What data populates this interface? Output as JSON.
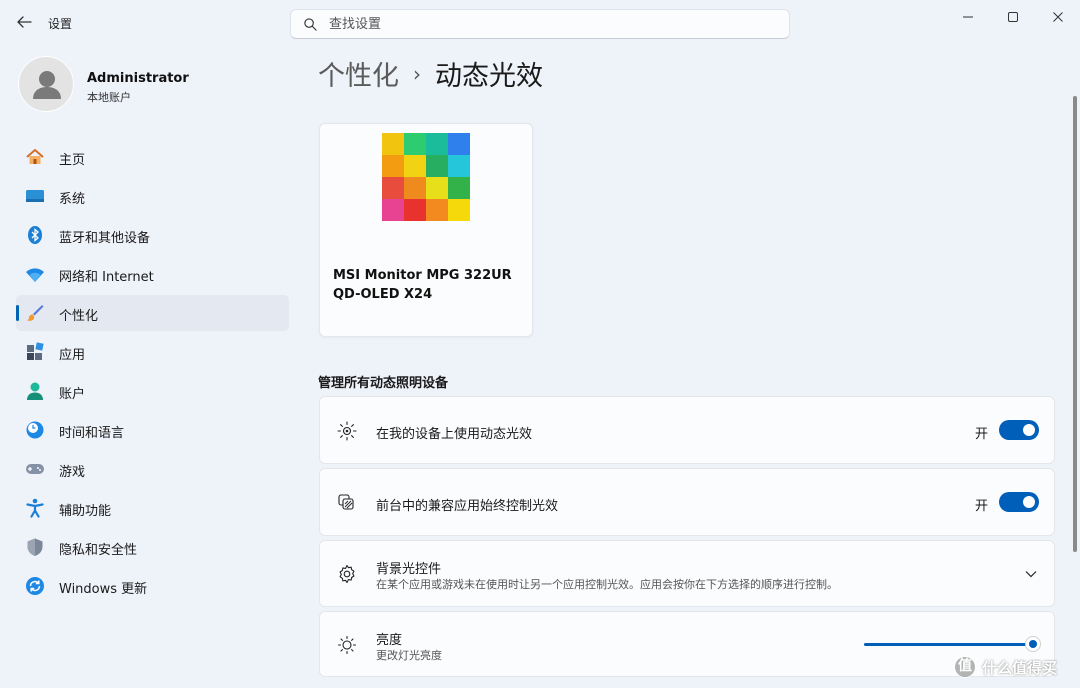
{
  "window": {
    "app_title": "设置",
    "controls": [
      "minimize-icon",
      "maximize-icon",
      "close-icon"
    ]
  },
  "search": {
    "placeholder": "查找设置",
    "value": ""
  },
  "profile": {
    "name": "Administrator",
    "account_type": "本地账户"
  },
  "sidebar": {
    "items": [
      {
        "label": "主页",
        "icon": "home-icon",
        "active": false
      },
      {
        "label": "系统",
        "icon": "system-icon",
        "active": false
      },
      {
        "label": "蓝牙和其他设备",
        "icon": "bluetooth-icon",
        "active": false
      },
      {
        "label": "网络和 Internet",
        "icon": "wifi-icon",
        "active": false
      },
      {
        "label": "个性化",
        "icon": "brush-icon",
        "active": true
      },
      {
        "label": "应用",
        "icon": "apps-icon",
        "active": false
      },
      {
        "label": "账户",
        "icon": "account-icon",
        "active": false
      },
      {
        "label": "时间和语言",
        "icon": "clock-globe-icon",
        "active": false
      },
      {
        "label": "游戏",
        "icon": "gamepad-icon",
        "active": false
      },
      {
        "label": "辅助功能",
        "icon": "accessibility-icon",
        "active": false
      },
      {
        "label": "隐私和安全性",
        "icon": "shield-icon",
        "active": false
      },
      {
        "label": "Windows 更新",
        "icon": "update-icon",
        "active": false
      }
    ]
  },
  "breadcrumb": {
    "parent": "个性化",
    "separator": "›",
    "current": "动态光效"
  },
  "device": {
    "name": "MSI Monitor MPG 322UR QD-OLED X24",
    "icon": "rgb-grid-icon"
  },
  "section": {
    "title": "管理所有动态照明设备"
  },
  "settings": {
    "use_dynamic_lighting": {
      "title": "在我的设备上使用动态光效",
      "state_label": "开",
      "enabled": true,
      "icon": "lighting-icon"
    },
    "foreground_control": {
      "title": "前台中的兼容应用始终控制光效",
      "state_label": "开",
      "enabled": true,
      "icon": "layers-icon"
    },
    "background_control": {
      "title": "背景光控件",
      "description": "在某个应用或游戏未在使用时让另一个应用控制光效。应用会按你在下方选择的顺序进行控制。",
      "icon": "gear-icon",
      "expanded": false
    },
    "brightness": {
      "title": "亮度",
      "description": "更改灯光亮度",
      "value_percent": 98,
      "icon": "sun-icon"
    }
  },
  "colors": {
    "accent": "#005fb8",
    "background": "#eef2f9",
    "card": "#fbfcfd"
  },
  "watermark": {
    "text": "什么值得买",
    "symbol": "值"
  }
}
